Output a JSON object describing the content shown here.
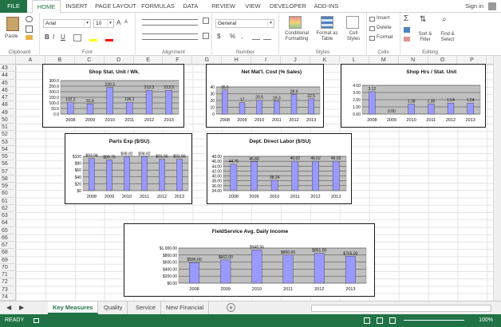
{
  "ribbon_tabs": [
    "FILE",
    "HOME",
    "INSERT",
    "PAGE LAYOUT",
    "FORMULAS",
    "DATA",
    "REVIEW",
    "VIEW",
    "DEVELOPER",
    "ADD-INS"
  ],
  "signin": "Sign in",
  "clipboard": {
    "paste": "Paste",
    "label": "Clipboard"
  },
  "font": {
    "name": "Arial",
    "size": "10",
    "label": "Font",
    "bold": "B",
    "italic": "I",
    "underline": "U",
    "grow": "A",
    "shrink": "A"
  },
  "alignment": {
    "label": "Alignment"
  },
  "number": {
    "format": "General",
    "currency": "$",
    "percent": "%",
    "comma": ",",
    "label": "Number"
  },
  "styles": {
    "conditional": "Conditional Formatting",
    "format_table": "Format as Table",
    "cell_styles": "Cell Styles",
    "label": "Styles"
  },
  "cells": {
    "insert": "Insert",
    "delete": "Delete",
    "format": "Format",
    "label": "Cells"
  },
  "editing": {
    "sort": "Sort & Filter",
    "find": "Find & Select",
    "label": "Editing"
  },
  "columns": [
    "A",
    "B",
    "C",
    "D",
    "E",
    "F",
    "G",
    "H",
    "I",
    "J",
    "K",
    "L",
    "M",
    "N",
    "O",
    "P"
  ],
  "rows": [
    "43",
    "44",
    "45",
    "46",
    "47",
    "48",
    "49",
    "50",
    "51",
    "52",
    "53",
    "54",
    "55",
    "56",
    "57",
    "58",
    "59",
    "60",
    "61",
    "62",
    "63",
    "64",
    "65",
    "66",
    "67",
    "68",
    "69",
    "70",
    "71",
    "72",
    "73",
    "74"
  ],
  "sheets": [
    "Key Measures",
    "Quality",
    "Service",
    "New Financial"
  ],
  "add_sheet": "+",
  "status": {
    "ready": "READY",
    "zoom": "100%"
  },
  "accent": "#217346",
  "bar_color": "#9999ff",
  "chart_data": [
    {
      "type": "bar",
      "title": "Shop Stat. Unit / Wk.",
      "categories": [
        "2008",
        "2009",
        "2010",
        "2011",
        "2012",
        "2013"
      ],
      "values": [
        102.2,
        91.6,
        239.3,
        106.1,
        213.3,
        213.3
      ],
      "labels": [
        "102.2",
        "91.6",
        "239.3",
        "106.1",
        "213.3",
        "213.3"
      ],
      "ylim": [
        0,
        300
      ],
      "yticks": [
        "300.0",
        "250.0",
        "200.0",
        "150.0",
        "100.0",
        "50.0",
        "0.0"
      ]
    },
    {
      "type": "bar",
      "title": "Net Mat'l. Cost (% Sales)",
      "categories": [
        "2008",
        "2009",
        "2010",
        "2011",
        "2012",
        "2013"
      ],
      "values": [
        35.5,
        17,
        20.5,
        19.3,
        28.9,
        22.5
      ],
      "labels": [
        "35.5",
        "17",
        "20.5",
        "19.3",
        "28.9",
        "22.5"
      ],
      "ylim": [
        0,
        40
      ],
      "yticks": [
        "40",
        "30",
        "20",
        "10",
        "0"
      ]
    },
    {
      "type": "bar",
      "title": "Shop Hrs / Stat. Unit",
      "categories": [
        "2008",
        "2009",
        "2010",
        "2011",
        "2012",
        "2013"
      ],
      "values": [
        3.12,
        0,
        1.38,
        1.38,
        1.54,
        1.54
      ],
      "labels": [
        "3.12",
        "0.00",
        "1.38",
        "1.38",
        "1.54",
        "1.54"
      ],
      "ylim": [
        0,
        4
      ],
      "yticks": [
        "4.00",
        "3.00",
        "2.00",
        "1.00",
        "0.00"
      ]
    },
    {
      "type": "bar",
      "title": "Parts Exp ($/SU)",
      "categories": [
        "2008",
        "2009",
        "2010",
        "2011",
        "2012",
        "2013"
      ],
      "values": [
        93.94,
        89.76,
        98.82,
        98.82,
        91.56,
        91.56
      ],
      "labels": [
        "$93.94",
        "$89.76",
        "$98.82",
        "$98.82",
        "$91.56",
        "$91.56"
      ],
      "ylim": [
        0,
        100
      ],
      "yticks": [
        "$100",
        "$80",
        "$60",
        "$40",
        "$20",
        "$0"
      ]
    },
    {
      "type": "bar",
      "title": "Dept. Direct Labor ($/SU)",
      "categories": [
        "2008",
        "2009",
        "2010",
        "2011",
        "2012",
        "2013"
      ],
      "values": [
        44.76,
        45.8,
        38.24,
        46.02,
        46.02,
        46.02
      ],
      "labels": [
        "44.76",
        "45.80",
        "38.24",
        "46.02",
        "46.02",
        "46.02"
      ],
      "ylim": [
        34,
        48
      ],
      "yticks": [
        "48.00",
        "46.00",
        "44.00",
        "42.00",
        "40.00",
        "38.00",
        "36.00",
        "34.00"
      ]
    },
    {
      "type": "bar",
      "title": "FieldService Avg. Daily Income",
      "categories": [
        "2008",
        "2009",
        "2010",
        "2011",
        "2012",
        "2013"
      ],
      "values": [
        586,
        662,
        948.56,
        800,
        851,
        765
      ],
      "labels": [
        "$586.00",
        "$662.00",
        "$948.56",
        "$800.00",
        "$851.00",
        "$765.00"
      ],
      "ylim": [
        0,
        1000
      ],
      "yticks": [
        "$1,000.00",
        "$800.00",
        "$600.00",
        "$400.00",
        "$200.00",
        "$0.00"
      ]
    }
  ]
}
